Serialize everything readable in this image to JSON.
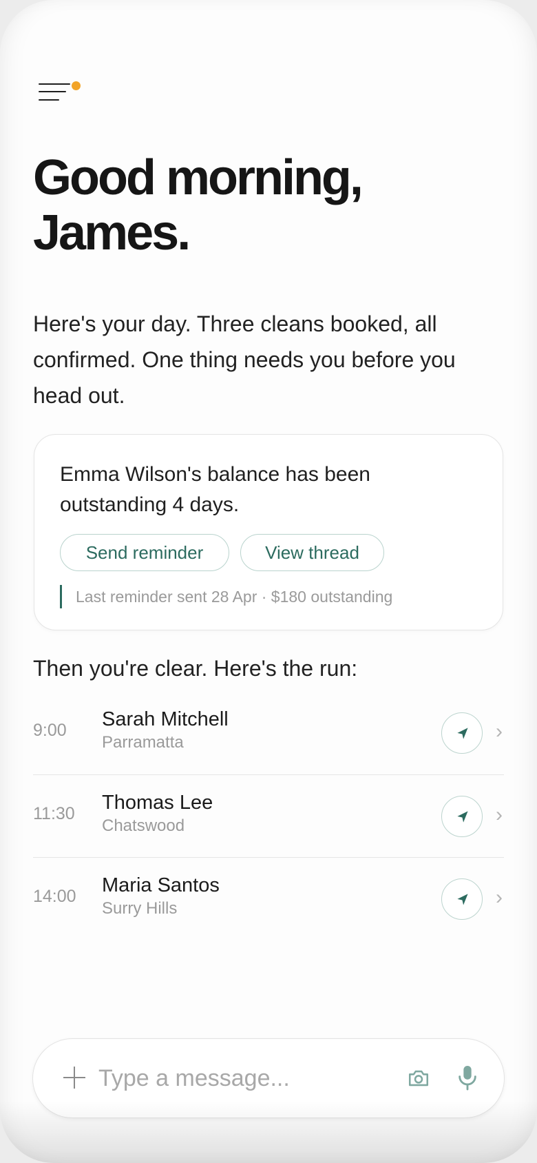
{
  "greeting": {
    "line1": "Good morning,",
    "line2": "James."
  },
  "intro": "Here's your day. Three cleans booked, all confirmed. One thing needs you before you head out.",
  "alert": {
    "message": "Emma Wilson's balance has been outstanding 4 days.",
    "send_reminder_label": "Send reminder",
    "view_thread_label": "View thread",
    "note": "Last reminder sent 28 Apr · $180 outstanding"
  },
  "run": {
    "heading": "Then you're clear. Here's the run:",
    "items": [
      {
        "time": "9:00",
        "name": "Sarah Mitchell",
        "suburb": "Parramatta"
      },
      {
        "time": "11:30",
        "name": "Thomas Lee",
        "suburb": "Chatswood"
      },
      {
        "time": "14:00",
        "name": "Maria Santos",
        "suburb": "Surry Hills"
      }
    ]
  },
  "composer": {
    "placeholder": "Type a message..."
  },
  "icons": {
    "menu": "menu-icon",
    "notification": "notification-dot",
    "navigate": "navigate-arrow-icon",
    "chevron": "chevron-right-icon",
    "add": "plus-icon",
    "camera": "camera-icon",
    "mic": "microphone-icon"
  },
  "colors": {
    "accent": "#2c6b5f",
    "notification": "#f2a428"
  }
}
